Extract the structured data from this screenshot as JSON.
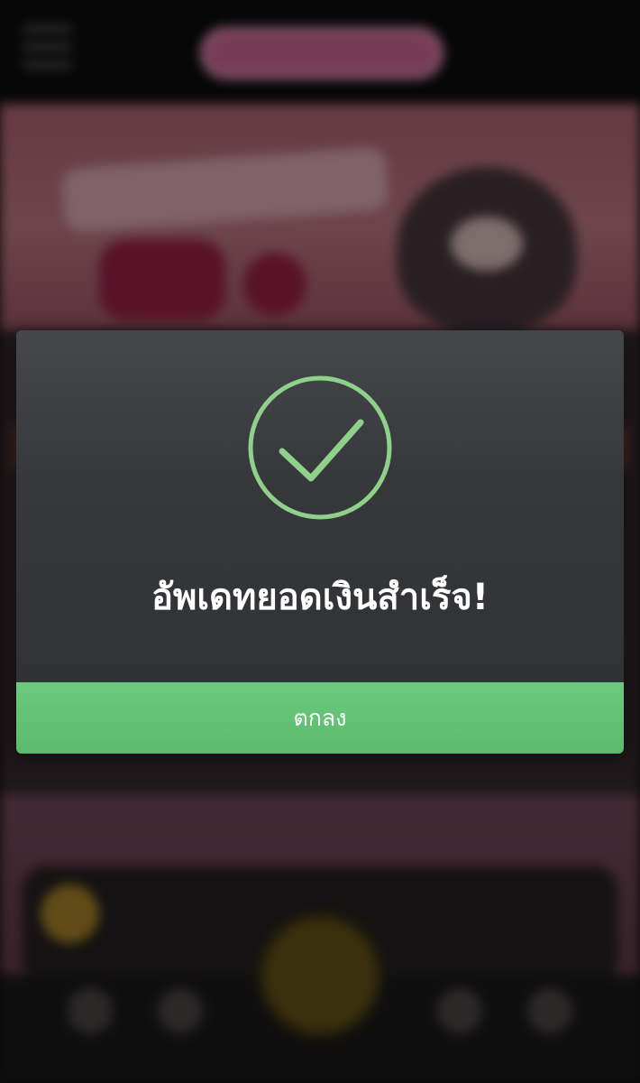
{
  "dialog": {
    "title": "อัพเดทยอดเงินสำเร็จ!",
    "ok_label": "ตกลง",
    "icon": "success-check-icon",
    "accent_color": "#8fd08a",
    "button_color": "#63c276"
  }
}
